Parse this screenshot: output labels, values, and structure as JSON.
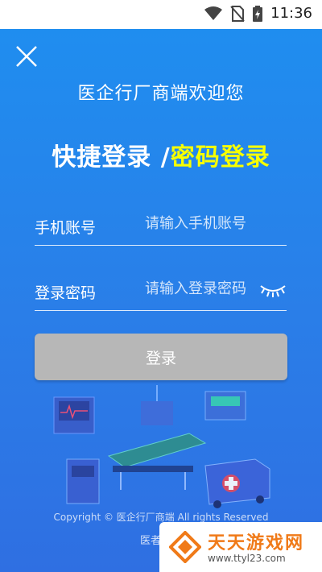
{
  "status_bar": {
    "time": "11:36"
  },
  "header": {
    "welcome_text": "医企行厂商端欢迎您"
  },
  "login_modes": {
    "quick": "快捷登录",
    "separator": " /",
    "password": "密码登录"
  },
  "form": {
    "phone": {
      "label": "手机账号",
      "placeholder": "请输入手机账号"
    },
    "password": {
      "label": "登录密码",
      "placeholder": "请输入登录密码"
    },
    "submit_label": "登录"
  },
  "footer": {
    "copyright": "Copyright © 医企行厂商端 All rights Reserved",
    "agreement_partial": "医者"
  },
  "watermark": {
    "title": "天天游戏网",
    "url": "www.ttyl23.com"
  },
  "colors": {
    "background": "#2a7ee8",
    "highlight": "#f7ff00",
    "button": "#b7b7b7",
    "watermark_accent": "#f07a18"
  }
}
